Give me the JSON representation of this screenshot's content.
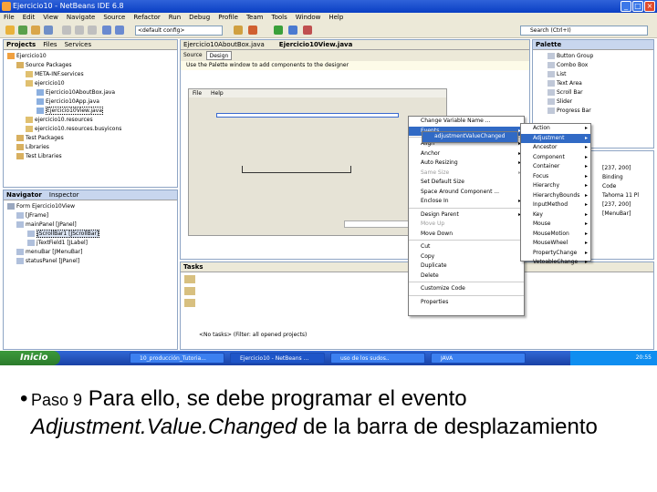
{
  "window": {
    "title": "Ejercicio10 - NetBeans IDE 6.8"
  },
  "menubar": [
    "File",
    "Edit",
    "View",
    "Navigate",
    "Source",
    "Refactor",
    "Run",
    "Debug",
    "Profile",
    "Team",
    "Tools",
    "Window",
    "Help"
  ],
  "toolbar": {
    "config_combo": "<default config>",
    "search_placeholder": "Search (Ctrl+I)"
  },
  "projects": {
    "tabs": [
      "Projects",
      "Files",
      "Services"
    ],
    "tree": [
      "Ejercicio10",
      "Source Packages",
      "META-INF.services",
      "ejercicio10",
      "Ejercicio10AboutBox.java",
      "Ejercicio10App.java",
      "Ejercicio10View.java",
      "ejercicio10.resources",
      "ejercicio10.resources.busyicons",
      "Test Packages",
      "Libraries",
      "Test Libraries"
    ]
  },
  "navigator": {
    "tabs": [
      "Navigator",
      "Inspector"
    ],
    "tree": [
      "Form Ejercicio10View",
      "[JFrame]",
      "mainPanel [JPanel]",
      "jScrollBar1 [JScrollBar]",
      "jTextField1 [JLabel]",
      "menuBar [JMenuBar]",
      "statusPanel [JPanel]"
    ]
  },
  "editor": {
    "tabs": [
      "Ejercicio10AboutBox.java",
      "Ejercicio10View.java"
    ],
    "modes": [
      "Source",
      "Design"
    ],
    "hint": "Use the Palette window to add components to the designer",
    "form_menu": [
      "File",
      "Help"
    ]
  },
  "context_menu": [
    "Change Variable Name ...",
    "Events",
    "Align",
    "Anchor",
    "Auto Resizing",
    "Same Size",
    "Set Default Size",
    "Space Around Component ...",
    "Enclose In",
    "Design Parent",
    "Move Up",
    "Move Down",
    "Cut",
    "Copy",
    "Duplicate",
    "Delete",
    "Customize Code",
    "Properties"
  ],
  "events_menu": [
    "Action",
    "Adjustment",
    "Ancestor",
    "Component",
    "Container",
    "Focus",
    "Hierarchy",
    "HierarchyBounds",
    "InputMethod",
    "Key",
    "Mouse",
    "MouseMotion",
    "MouseWheel",
    "PropertyChange",
    "VetoableChange"
  ],
  "adjustment_menu": [
    "adjustmentValueChanged"
  ],
  "palette": {
    "title": "Palette",
    "items": [
      "Button Group",
      "Combo Box",
      "List",
      "Text Area",
      "Scroll Bar",
      "Slider",
      "Progress Bar"
    ]
  },
  "properties": {
    "values": [
      "[237, 200]",
      "Binding",
      "Code",
      "Tahoma 11 Pl",
      "[237, 200]",
      "[MenuBar]"
    ]
  },
  "tasks": {
    "title": "Tasks",
    "status": "<No tasks> (Filter: all opened projects)"
  },
  "taskbar": {
    "start": "Inicio",
    "tasks": [
      "10_producción_Tutoria...",
      "Ejercicio10 - NetBeans ...",
      "uso de los sudos..",
      "JAVA"
    ],
    "tray": "20:55"
  },
  "caption": {
    "step": "Paso 9",
    "text_1": "Para ello, se debe programar el evento",
    "event": "Adjustment.Value.Changed",
    "text_2": "de la barra de desplazamiento"
  }
}
